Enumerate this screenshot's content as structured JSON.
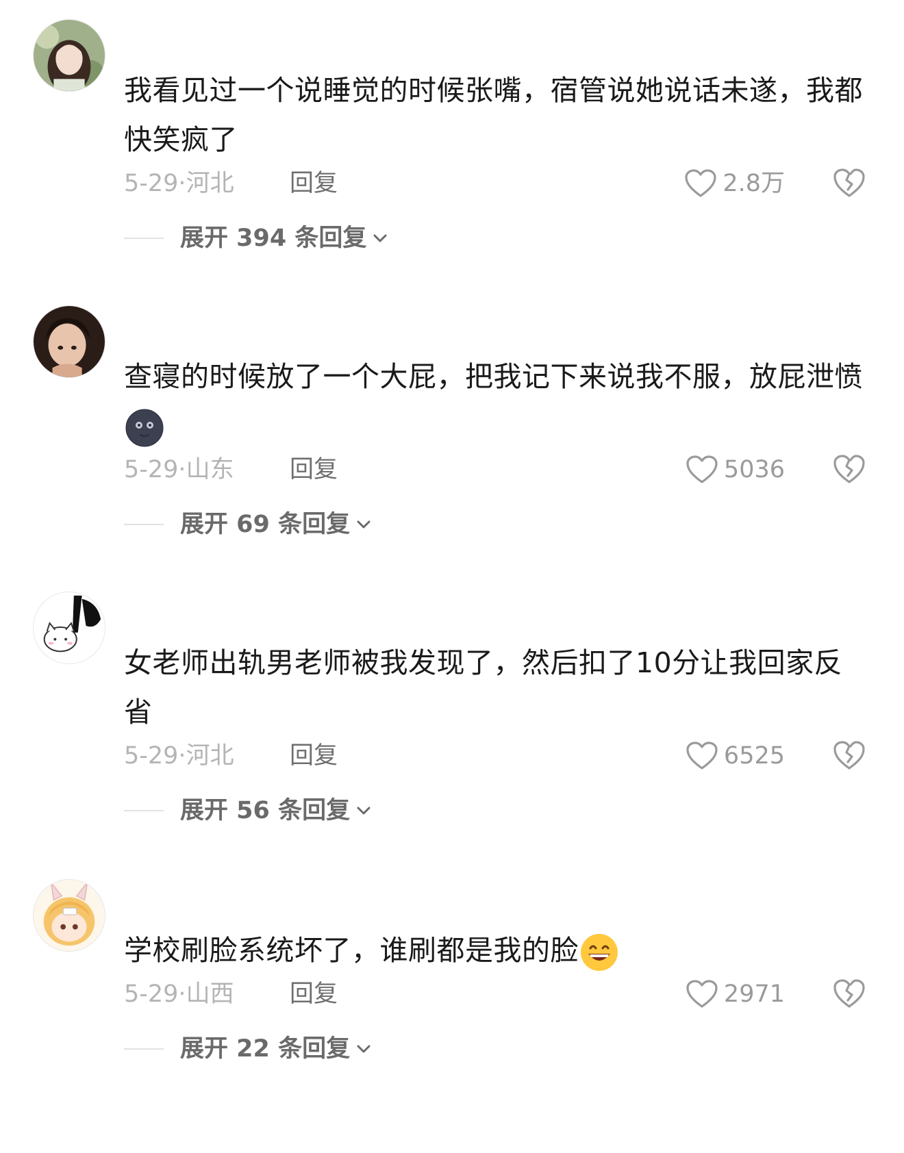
{
  "comments": [
    {
      "text": "我看见过一个说睡觉的时候张嘴，宿管说她说话未遂，我都快笑疯了",
      "date": "5-29·",
      "location": "河北",
      "reply_label": "回复",
      "likes": "2.8万",
      "expand_label": "展开 394 条回复",
      "avatar_icon": "avatar-girl-garden",
      "emoji_icon": ""
    },
    {
      "text": "查寝的时候放了一个大屁，把我记下来说我不服，放屁泄愤",
      "date": "5-29·",
      "location": "山东",
      "reply_label": "回复",
      "likes": "5036",
      "expand_label": "展开 69 条回复",
      "avatar_icon": "avatar-girl-dark",
      "emoji_icon": "new-moon-face-emoji"
    },
    {
      "text": "女老师出轨男老师被我发现了，然后扣了10分让我回家反省",
      "date": "5-29·",
      "location": "河北",
      "reply_label": "回复",
      "likes": "6525",
      "expand_label": "展开 56 条回复",
      "avatar_icon": "avatar-cartoon-cat",
      "emoji_icon": ""
    },
    {
      "text": "学校刷脸系统坏了，谁刷都是我的脸",
      "date": "5-29·",
      "location": "山西",
      "reply_label": "回复",
      "likes": "2971",
      "expand_label": "展开 22 条回复",
      "avatar_icon": "avatar-anime-bunny",
      "emoji_icon": "grinning-face-emoji"
    }
  ],
  "icons": {
    "like": "heart-outline-icon",
    "dislike": "broken-heart-icon",
    "expand": "chevron-down-icon"
  },
  "colors": {
    "text": "#1a1a1a",
    "meta": "#b4b4b4",
    "reply": "#6f6f6f",
    "expand": "#6a6a6a",
    "like": "#9a9a9a"
  }
}
